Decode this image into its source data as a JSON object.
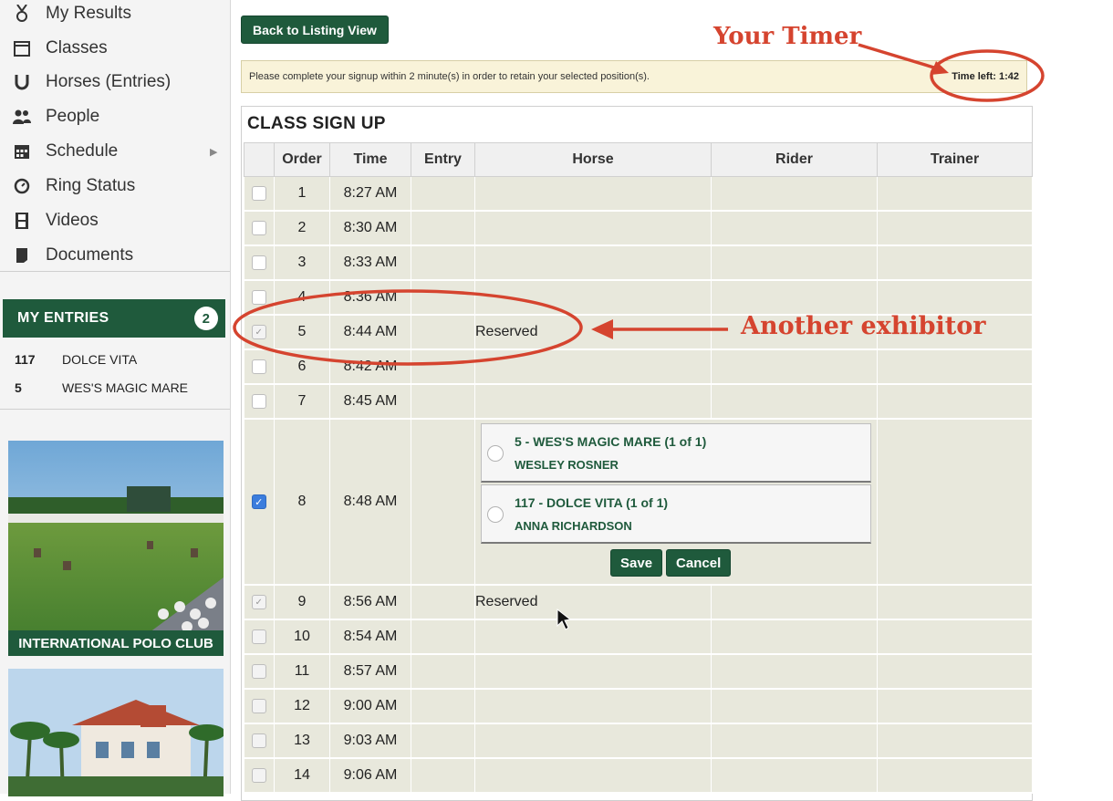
{
  "sidebar": {
    "nav": [
      {
        "label": "My Results",
        "icon": "medal-icon"
      },
      {
        "label": "Classes",
        "icon": "calendar-icon"
      },
      {
        "label": "Horses (Entries)",
        "icon": "horseshoe-icon"
      },
      {
        "label": "People",
        "icon": "people-icon"
      },
      {
        "label": "Schedule",
        "icon": "schedule-icon"
      },
      {
        "label": "Ring Status",
        "icon": "gauge-icon"
      },
      {
        "label": "Videos",
        "icon": "film-icon"
      },
      {
        "label": "Documents",
        "icon": "document-icon"
      }
    ],
    "my_entries": {
      "title": "MY ENTRIES",
      "count": "2",
      "items": [
        {
          "number": "117",
          "name": "DOLCE VITA"
        },
        {
          "number": "5",
          "name": "WES'S MAGIC MARE"
        }
      ]
    },
    "ads": [
      {
        "caption": "INTERNATIONAL POLO CLUB"
      },
      {
        "caption": ""
      }
    ]
  },
  "main": {
    "back_button": "Back to Listing View",
    "notice": "Please complete your signup within 2 minute(s) in order to retain your selected position(s).",
    "timer": "Time left: 1:42",
    "panel_title": "CLASS SIGN UP",
    "columns": [
      "Order",
      "Time",
      "Entry",
      "Horse",
      "Rider",
      "Trainer"
    ],
    "rows": [
      {
        "order": "1",
        "time": "8:27 AM",
        "horse": "",
        "state": "open"
      },
      {
        "order": "2",
        "time": "8:30 AM",
        "horse": "",
        "state": "open"
      },
      {
        "order": "3",
        "time": "8:33 AM",
        "horse": "",
        "state": "open"
      },
      {
        "order": "4",
        "time": "8:36 AM",
        "horse": "",
        "state": "open"
      },
      {
        "order": "5",
        "time": "8:44 AM",
        "horse": "Reserved",
        "state": "reserved"
      },
      {
        "order": "6",
        "time": "8:42 AM",
        "horse": "",
        "state": "open"
      },
      {
        "order": "7",
        "time": "8:45 AM",
        "horse": "",
        "state": "open"
      },
      {
        "order": "8",
        "time": "8:48 AM",
        "horse": "",
        "state": "selected"
      },
      {
        "order": "9",
        "time": "8:56 AM",
        "horse": "Reserved",
        "state": "reserved"
      },
      {
        "order": "10",
        "time": "8:54 AM",
        "horse": "",
        "state": "disabled"
      },
      {
        "order": "11",
        "time": "8:57 AM",
        "horse": "",
        "state": "disabled"
      },
      {
        "order": "12",
        "time": "9:00 AM",
        "horse": "",
        "state": "disabled"
      },
      {
        "order": "13",
        "time": "9:03 AM",
        "horse": "",
        "state": "disabled"
      },
      {
        "order": "14",
        "time": "9:06 AM",
        "horse": "",
        "state": "disabled"
      }
    ],
    "picker": {
      "options": [
        {
          "line1": "5 - WES'S MAGIC MARE (1 of 1)",
          "line2": "WESLEY ROSNER"
        },
        {
          "line1": "117 - DOLCE VITA (1 of 1)",
          "line2": "ANNA RICHARDSON"
        }
      ],
      "save": "Save",
      "cancel": "Cancel"
    }
  },
  "annotations": {
    "timer_label": "Your Timer",
    "exhibitor_label": "Another exhibitor",
    "color": "#d5442f"
  },
  "colors": {
    "brand_green": "#1f5a3c",
    "notice_bg": "#f9f3d9",
    "row_bg": "#e8e8dc",
    "checkbox_blue": "#3b7ddd"
  }
}
